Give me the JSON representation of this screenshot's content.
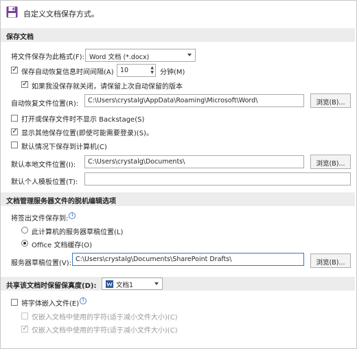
{
  "header": {
    "title": "自定义文档保存方式。"
  },
  "save": {
    "section_title": "保存文档",
    "format_label": "将文件保存为此格式(F):",
    "format_value": "Word 文档 (*.docx)",
    "autorecover_label": "保存自动恢复信息时间间隔(A)",
    "autorecover_minutes": "10",
    "minutes_label": "分钟(M)",
    "keep_last_label": "如果我没保存就关闭，请保留上次自动保留的版本",
    "autorecover_location_label": "自动恢复文件位置(R):",
    "autorecover_location_value": "C:\\Users\\crystalg\\AppData\\Roaming\\Microsoft\\Word\\",
    "browse_label": "浏览(B)...",
    "no_backstage_label": "打开或保存文件时不显示 Backstage(S)",
    "show_additional_label": "显示其他保存位置(即使可能需要登录)(S)。",
    "default_computer_label": "默认情况下保存到计算机(C)",
    "default_local_label": "默认本地文件位置(I):",
    "default_local_value": "C:\\Users\\crystalg\\Documents\\",
    "default_template_label": "默认个人模板位置(T):",
    "default_template_value": ""
  },
  "offline": {
    "section_title": "文档管理服务器文件的脱机编辑选项",
    "saveto_label": "将签出文件保存到:",
    "option_server_drafts": "此计算机的服务器草稿位置(L)",
    "option_office_cache": "Office 文档缓存(O)",
    "drafts_location_label": "服务器草稿位置(V):",
    "drafts_location_value": "C:\\Users\\crystalg\\Documents\\SharePoint Drafts\\",
    "browse_label": "浏览(B)..."
  },
  "fidelity": {
    "section_title": "共享该文档时保留保真度(D):",
    "doc_value": "文档1",
    "embed_fonts_label": "将字体嵌入文件(E)",
    "embed_chars_label": "仅嵌入文档中使用的字符(适于减小文件大小)(C)",
    "no_system_fonts_label": "仅嵌入文档中使用的字符(适于减小文件大小)(C)"
  }
}
